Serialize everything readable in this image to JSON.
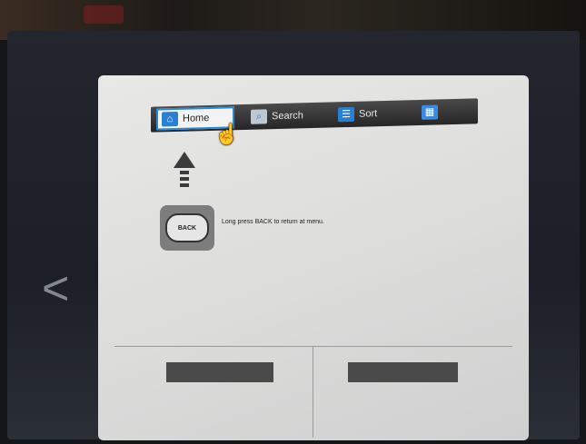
{
  "tabs": [
    {
      "label": "Home",
      "icon": "home-icon",
      "active": true
    },
    {
      "label": "Search",
      "icon": "search-icon",
      "active": false
    },
    {
      "label": "Sort",
      "icon": "sort-icon",
      "active": false
    },
    {
      "label": "",
      "icon": "grid-icon",
      "active": false
    }
  ],
  "back_key_label": "BACK",
  "hint_text": "Long press BACK to return at menu.",
  "left_arrow_glyph": "<",
  "colors": {
    "active_tab_border": "#2a88d8",
    "tabbar_background": "#333333",
    "panel_background": "#e0e0df"
  }
}
